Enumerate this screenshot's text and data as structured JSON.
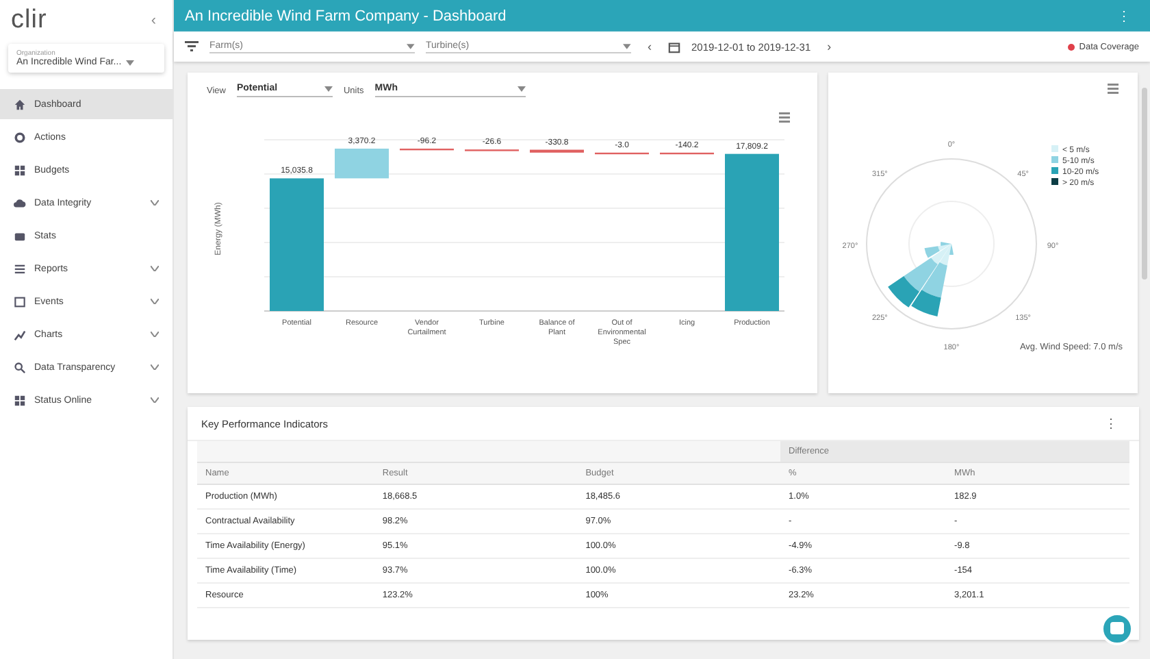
{
  "sidebar": {
    "logo": "clir",
    "collapse_icon": "‹",
    "org_select": {
      "label": "Organization",
      "value": "An Incredible Wind Far..."
    },
    "items": [
      {
        "label": "Dashboard",
        "selected": true,
        "expandable": false
      },
      {
        "label": "Actions",
        "selected": false,
        "expandable": false
      },
      {
        "label": "Budgets",
        "selected": false,
        "expandable": false
      },
      {
        "label": "Data Integrity",
        "selected": false,
        "expandable": true
      },
      {
        "label": "Stats",
        "selected": false,
        "expandable": false
      },
      {
        "label": "Reports",
        "selected": false,
        "expandable": true
      },
      {
        "label": "Events",
        "selected": false,
        "expandable": true
      },
      {
        "label": "Charts",
        "selected": false,
        "expandable": true
      },
      {
        "label": "Data Transparency",
        "selected": false,
        "expandable": true
      },
      {
        "label": "Status Online",
        "selected": false,
        "expandable": true
      }
    ]
  },
  "header": {
    "title": "An Incredible Wind Farm Company - Dashboard",
    "menu": "⋮"
  },
  "filters": {
    "farms": {
      "placeholder": "Farm(s)"
    },
    "turbines": {
      "placeholder": "Turbine(s)"
    },
    "prev": "‹",
    "date_range": "2019-12-01 to 2019-12-31",
    "next": "›",
    "coverage": {
      "label": "Data Coverage",
      "color": "#e0404a"
    }
  },
  "energy_card": {
    "view": {
      "label": "View",
      "value": "Potential"
    },
    "units": {
      "label": "Units",
      "value": "MWh"
    },
    "waterfall": {
      "ylabel": "Energy (MWh)",
      "bars": [
        {
          "category": "Potential",
          "value": "15,035.8",
          "kind": "total"
        },
        {
          "category": "Resource",
          "value": "3,370.2",
          "kind": "step"
        },
        {
          "category": "Vendor Curtailment",
          "value": "-96.2",
          "kind": "step"
        },
        {
          "category": "Turbine",
          "value": "-26.6",
          "kind": "step"
        },
        {
          "category": "Balance of Plant",
          "value": "-330.8",
          "kind": "step"
        },
        {
          "category": "Out of Environmental Spec",
          "value": "-3.0",
          "kind": "step"
        },
        {
          "category": "Icing",
          "value": "-140.2",
          "kind": "step"
        },
        {
          "category": "Production",
          "value": "17,809.2",
          "kind": "total"
        }
      ]
    }
  },
  "wind_card": {
    "directions": [
      "0°",
      "45°",
      "90°",
      "135°",
      "180°",
      "225°",
      "270°",
      "315°"
    ],
    "legend": [
      {
        "label": "< 5 m/s",
        "color": "#d6f1f6"
      },
      {
        "label": "5-10 m/s",
        "color": "#8fd3e2"
      },
      {
        "label": "10-20 m/s",
        "color": "#2aa3b5"
      },
      {
        "label": "> 20 m/s",
        "color": "#0c3d45"
      }
    ],
    "avg": "Avg. Wind Speed: 7.0 m/s"
  },
  "kpi": {
    "title": "Key Performance Indicators",
    "menu": "⋮",
    "group": "Difference",
    "columns": [
      "Name",
      "Result",
      "Budget",
      "%",
      "MWh"
    ],
    "rows": [
      [
        "Production (MWh)",
        "18,668.5",
        "18,485.6",
        "1.0%",
        "182.9"
      ],
      [
        "Contractual Availability",
        "98.2%",
        "97.0%",
        "-",
        "-"
      ],
      [
        "Time Availability (Energy)",
        "95.1%",
        "100.0%",
        "-4.9%",
        "-9.8"
      ],
      [
        "Time Availability (Time)",
        "93.7%",
        "100.0%",
        "-6.3%",
        "-154"
      ],
      [
        "Resource",
        "123.2%",
        "100%",
        "23.2%",
        "3,201.1"
      ]
    ]
  }
}
